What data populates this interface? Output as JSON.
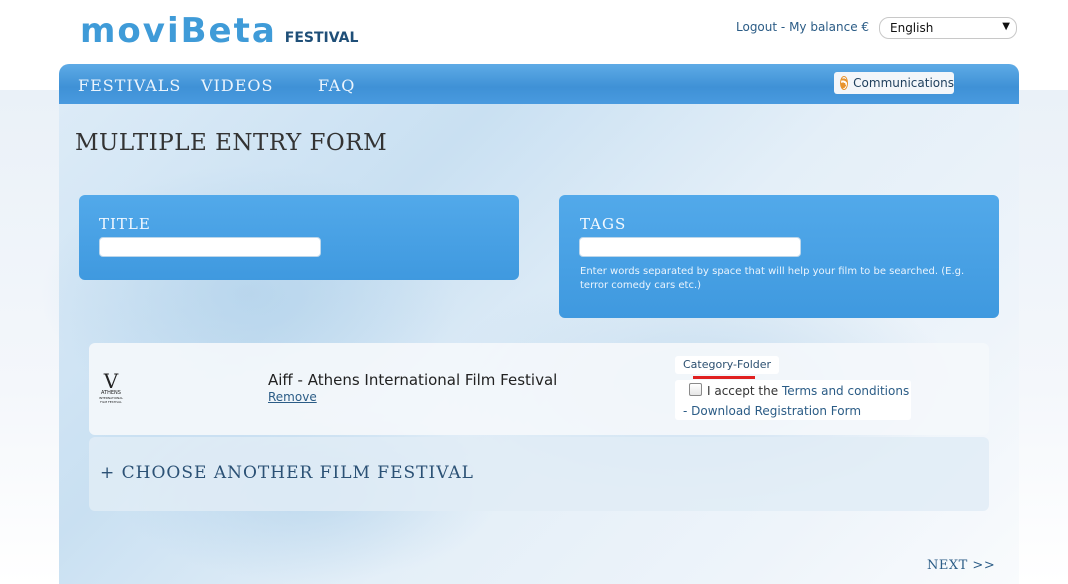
{
  "header": {
    "logo_main": "moviBeta",
    "logo_sub": "FESTIVAL",
    "logout_text": "Logout",
    "separator": " - ",
    "balance_text": "My balance €",
    "language": "English"
  },
  "nav": {
    "items": [
      {
        "label": "FESTIVALS"
      },
      {
        "label": "VIDEOS"
      },
      {
        "label": "FAQ"
      }
    ],
    "communications": "Communications"
  },
  "page": {
    "title": "MULTIPLE ENTRY FORM"
  },
  "form": {
    "title_label": "TITLE",
    "title_value": "",
    "tags_label": "TAGS",
    "tags_value": "",
    "tags_hint": "Enter words separated by space that will help your film to be searched. (E.g. terror comedy cars etc.)"
  },
  "festival": {
    "logo_letter": "V",
    "logo_text": "ATHENS",
    "logo_subtext": "INTERNATIONAL FILM FESTIVAL",
    "name": "Aiff - Athens International Film Festival",
    "remove": "Remove",
    "category": "Category-Folder",
    "accept_prefix": "I accept the ",
    "terms_link": "Terms and conditions",
    "download": "- Download Registration Form",
    "accepted": false
  },
  "choose_another": "+ CHOOSE ANOTHER FILM FESTIVAL",
  "next": "NEXT >>",
  "colors": {
    "brand_blue": "#3f9bd8",
    "nav_blue": "#4a9be0",
    "box_blue": "#4aa3e6",
    "link_blue": "#2b5c86",
    "highlight_red": "#e02020"
  }
}
